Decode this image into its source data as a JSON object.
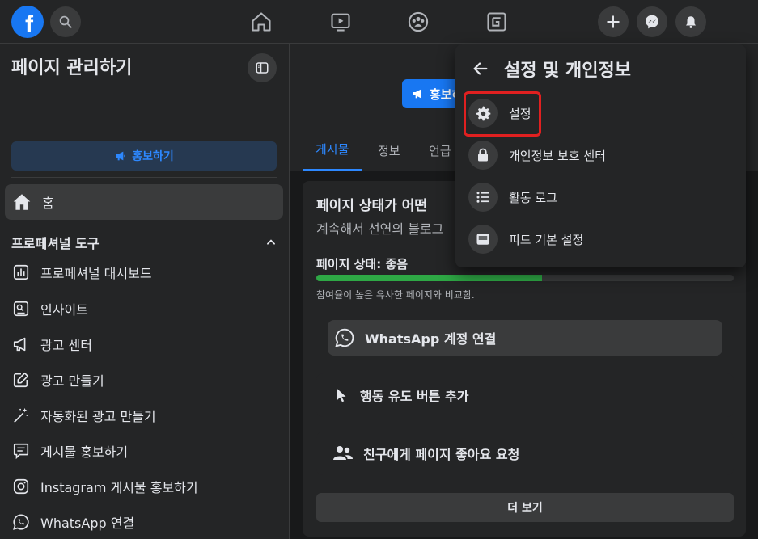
{
  "topbar": {
    "logo_letter": "f",
    "icons": [
      "search-icon",
      "home-icon",
      "video-icon",
      "groups-icon",
      "gaming-icon",
      "create-icon",
      "messenger-icon",
      "notifications-icon"
    ]
  },
  "sidebar": {
    "title": "페이지 관리하기",
    "promote_label": "홍보하기",
    "home_label": "홈",
    "section_title": "프로페셔널 도구",
    "items": [
      {
        "label": "프로페셔널 대시보드",
        "icon": "dashboard-icon"
      },
      {
        "label": "인사이트",
        "icon": "insights-icon"
      },
      {
        "label": "광고 센터",
        "icon": "megaphone-icon"
      },
      {
        "label": "광고 만들기",
        "icon": "edit-icon"
      },
      {
        "label": "자동화된 광고 만들기",
        "icon": "magic-wand-icon"
      },
      {
        "label": "게시물 홍보하기",
        "icon": "chat-post-icon"
      },
      {
        "label": "Instagram 게시물 홍보하기",
        "icon": "instagram-icon"
      },
      {
        "label": "WhatsApp 연결",
        "icon": "whatsapp-icon"
      }
    ]
  },
  "main": {
    "promote_button": "홍보하",
    "tabs": [
      "게시물",
      "정보",
      "언급"
    ],
    "card": {
      "title": "페이지 상태가 어떤",
      "subtitle": "계속해서 선연의 블로그",
      "status_label": "페이지 상태: 좋음",
      "status_progress_percent": 54,
      "compare_text": "참여율이 높은 유사한 페이지와 비교함.",
      "actions": [
        {
          "label": "WhatsApp 계정 연결",
          "icon": "whatsapp-icon"
        },
        {
          "label": "행동 유도 버튼 추가",
          "icon": "cursor-icon"
        },
        {
          "label": "친구에게 페이지 좋아요 요청",
          "icon": "friends-icon"
        }
      ],
      "more_label": "더 보기"
    }
  },
  "dropdown": {
    "title": "설정 및 개인정보",
    "items": [
      {
        "label": "설정",
        "icon": "gear-icon"
      },
      {
        "label": "개인정보 보호 센터",
        "icon": "lock-icon"
      },
      {
        "label": "활동 로그",
        "icon": "list-icon"
      },
      {
        "label": "피드 기본 설정",
        "icon": "feed-icon"
      }
    ]
  },
  "colors": {
    "accent": "#2d88ff",
    "brand": "#1877f2",
    "progress": "#2ea845",
    "highlight": "#e02020"
  }
}
